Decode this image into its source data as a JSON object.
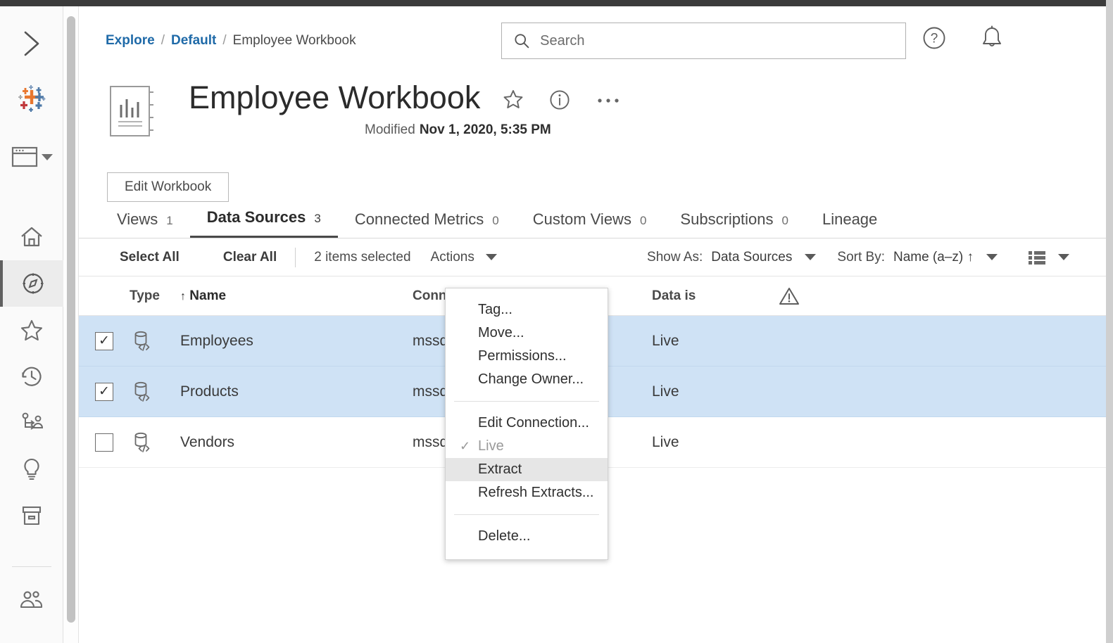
{
  "breadcrumb": {
    "root": "Explore",
    "project": "Default",
    "current": "Employee Workbook",
    "separator": "/"
  },
  "search": {
    "placeholder": "Search",
    "value": ""
  },
  "header_icons": {
    "help": "help-circle-icon",
    "notifications": "bell-icon"
  },
  "workbook": {
    "title": "Employee Workbook",
    "modified_label": "Modified",
    "modified_value": "Nov 1, 2020, 5:35 PM",
    "edit_button": "Edit Workbook",
    "icon": "workbook-icon",
    "actions": {
      "favorite": "star-icon",
      "info": "info-circle-icon",
      "more": "more-options-icon"
    }
  },
  "tabs": [
    {
      "label": "Views",
      "count": "1",
      "active": false
    },
    {
      "label": "Data Sources",
      "count": "3",
      "active": true
    },
    {
      "label": "Connected Metrics",
      "count": "0",
      "active": false
    },
    {
      "label": "Custom Views",
      "count": "0",
      "active": false
    },
    {
      "label": "Subscriptions",
      "count": "0",
      "active": false
    },
    {
      "label": "Lineage",
      "count": "",
      "active": false
    }
  ],
  "toolbar": {
    "select_all": "Select All",
    "clear_all": "Clear All",
    "selected_count": "2 items selected",
    "actions_label": "Actions",
    "show_as_label": "Show As:",
    "show_as_value": "Data Sources",
    "sort_by_label": "Sort By:",
    "sort_by_value": "Name (a–z) ↑",
    "view_mode_icon": "list-view-icon"
  },
  "actions_menu": {
    "groups": [
      [
        {
          "label": "Tag...",
          "state": "normal"
        },
        {
          "label": "Move...",
          "state": "normal"
        },
        {
          "label": "Permissions...",
          "state": "normal"
        },
        {
          "label": "Change Owner...",
          "state": "normal"
        }
      ],
      [
        {
          "label": "Edit Connection...",
          "state": "normal"
        },
        {
          "label": "Live",
          "state": "disabled",
          "checked": true
        },
        {
          "label": "Extract",
          "state": "hover"
        },
        {
          "label": "Refresh Extracts...",
          "state": "normal"
        }
      ],
      [
        {
          "label": "Delete...",
          "state": "normal"
        }
      ]
    ]
  },
  "table": {
    "columns": {
      "type": "Type",
      "name": "Name",
      "name_sort_arrow": "↑",
      "connects_to": "Connects to",
      "data_is": "Data is",
      "warning": "warning-icon"
    },
    "rows": [
      {
        "name": "Employees",
        "connects_to": "mssql.test.tsi.lan",
        "data_is": "Live",
        "selected": true,
        "checked": true
      },
      {
        "name": "Products",
        "connects_to": "mssql.test.tsi.lan",
        "data_is": "Live",
        "selected": true,
        "checked": true
      },
      {
        "name": "Vendors",
        "connects_to": "mssql.test.tsi.lan",
        "data_is": "Live",
        "selected": false,
        "checked": false
      }
    ],
    "checkbox_tick": "✓"
  },
  "sidebar": {
    "collapse_icon": "chevron-right-icon",
    "brand_icon": "tableau-logo-icon",
    "items": [
      {
        "name": "window-icon",
        "active": false
      },
      {
        "name": "home-icon",
        "active": false
      },
      {
        "name": "compass-explore-icon",
        "active": true
      },
      {
        "name": "star-favorites-icon",
        "active": false
      },
      {
        "name": "clock-recents-icon",
        "active": false
      },
      {
        "name": "shared-with-me-icon",
        "active": false
      },
      {
        "name": "lightbulb-icon",
        "active": false
      },
      {
        "name": "collections-box-icon",
        "active": false
      },
      {
        "name": "users-people-icon",
        "active": false
      }
    ]
  },
  "colors": {
    "link": "#1f6aa8",
    "selected_row": "#cfe2f5",
    "menu_hover": "#e6e6e6",
    "active_rail": "#ececec",
    "text": "#3a3a3a"
  }
}
